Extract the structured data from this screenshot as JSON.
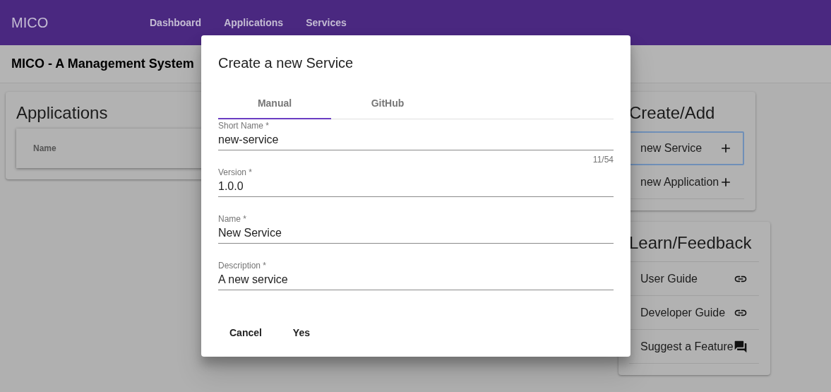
{
  "toolbar": {
    "brand": "MICO",
    "nav": [
      "Dashboard",
      "Applications",
      "Services"
    ]
  },
  "subtitle": "MICO - A Management System",
  "applications_card": {
    "title": "Applications",
    "columns": [
      "Name"
    ]
  },
  "create_card": {
    "title": "Create/Add",
    "items": [
      {
        "label": "new Service",
        "focused": true
      },
      {
        "label": "new Application",
        "focused": false
      }
    ]
  },
  "learn_card": {
    "title": "Learn/Feedback",
    "items": [
      {
        "label": "User Guide",
        "kind": "link"
      },
      {
        "label": "Developer Guide",
        "kind": "link"
      },
      {
        "label": "Suggest a Feature",
        "kind": "feedback"
      }
    ]
  },
  "dialog": {
    "title": "Create a new Service",
    "tabs": [
      {
        "label": "Manual",
        "selected": true
      },
      {
        "label": "GitHub",
        "selected": false
      }
    ],
    "fields": [
      {
        "label": "Short Name *",
        "value": "new-service",
        "counter": "11/54"
      },
      {
        "label": "Version *",
        "value": "1.0.0"
      },
      {
        "label": "Name *",
        "value": "New Service"
      },
      {
        "label": "Description *",
        "value": "A new service"
      }
    ],
    "buttons": [
      "Cancel",
      "Yes"
    ]
  }
}
